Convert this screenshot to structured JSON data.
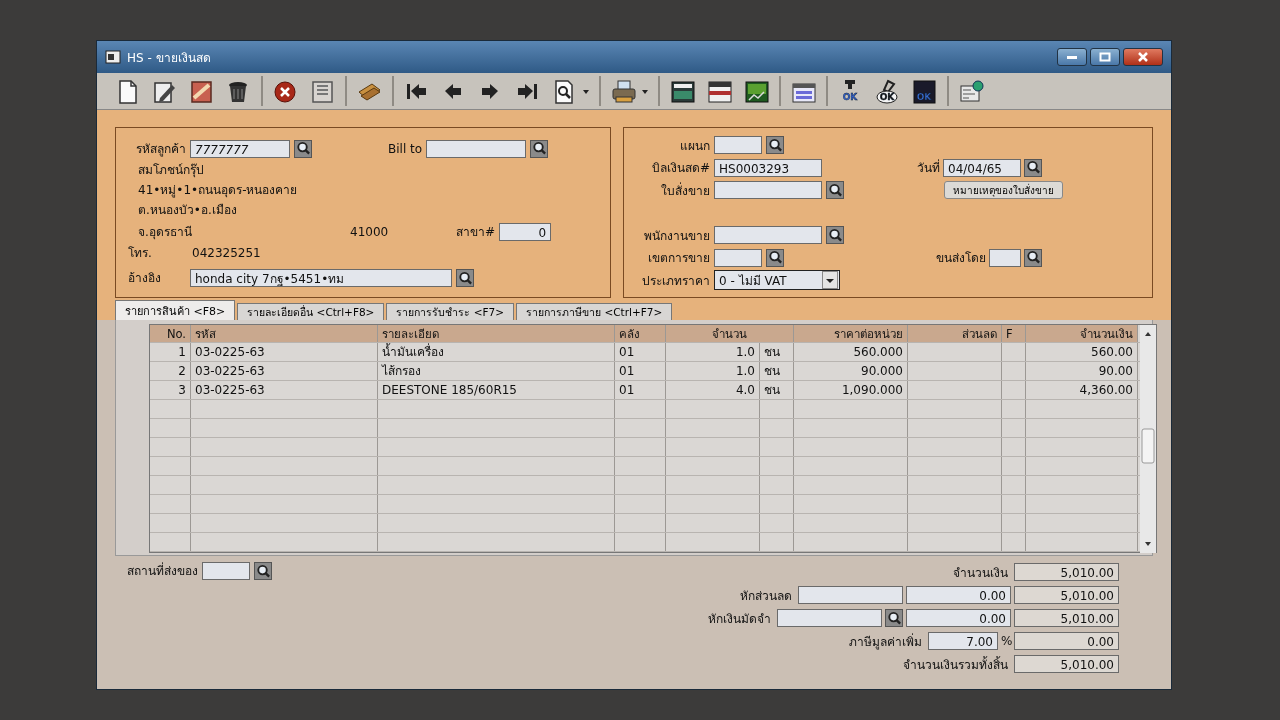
{
  "window": {
    "title": "HS - ขายเงินสด"
  },
  "toolbar": [
    [
      {
        "kind": "new"
      },
      {
        "kind": "edit"
      },
      {
        "kind": "void"
      },
      {
        "kind": "trash"
      }
    ],
    [
      {
        "kind": "cancel"
      },
      {
        "kind": "save"
      }
    ],
    [
      {
        "kind": "pay"
      }
    ],
    [
      {
        "kind": "first"
      },
      {
        "kind": "prev"
      },
      {
        "kind": "next"
      },
      {
        "kind": "last"
      },
      {
        "kind": "find",
        "dropdown": true
      }
    ],
    [
      {
        "kind": "print",
        "dropdown": true
      }
    ],
    [
      {
        "kind": "note"
      },
      {
        "kind": "card"
      },
      {
        "kind": "so"
      }
    ],
    [
      {
        "kind": "calendar"
      }
    ],
    [
      {
        "kind": "okdown",
        "text": "OK"
      },
      {
        "kind": "okpen",
        "text": "OK"
      },
      {
        "kind": "okdoc",
        "text": "OK"
      }
    ],
    [
      {
        "kind": "settings"
      }
    ]
  ],
  "customer": {
    "code_label": "รหัสลูกค้า",
    "code": "7777777",
    "bill_to_label": "Bill to",
    "name": "สมโภชน์กรุ๊ป",
    "address": [
      "41•หมู่•1•ถนนอุดร-หนองคาย",
      "ต.หนองบัว•อ.เมือง",
      "จ.อุดรธานี"
    ],
    "postcode": "41000",
    "branch_label": "สาขา#",
    "branch": "0",
    "phone_label": "โทร.",
    "phone": "042325251",
    "ref_label": "อ้างอิง",
    "ref": "honda city 7กฐ•5451•ทม"
  },
  "document": {
    "department_label": "แผนก",
    "cash_bill_label": "บิลเงินสด#",
    "cash_bill": "HS0003293",
    "date_label": "วันที่",
    "date": "04/04/65",
    "sales_order_label": "ใบสั่งขาย",
    "note_button": "หมายเหตุของใบสั่งขาย",
    "salesperson_label": "พนักงานขาย",
    "sales_area_label": "เขตการขาย",
    "shipped_by_label": "ขนส่งโดย",
    "price_type_label": "ประเภทราคา",
    "price_type": "0 - ไม่มี VAT"
  },
  "tabs": [
    {
      "label": "รายการสินค้า <F8>",
      "selected": true
    },
    {
      "label": "รายละเอียดอื่น  <Ctrl+F8>",
      "selected": false
    },
    {
      "label": "รายการรับชำระ <F7>",
      "selected": false
    },
    {
      "label": "รายการภาษีขาย <Ctrl+F7>",
      "selected": false
    }
  ],
  "table": {
    "columns": [
      "No.",
      "รหัส",
      "รายละเอียด",
      "คลัง",
      "จำนวน",
      "ราคาต่อหน่วย",
      "ส่วนลด",
      "F",
      "จำนวนเงิน"
    ],
    "rows": [
      {
        "no": "1",
        "code": "03-0225-63",
        "description": "น้ำมันเครื่อง",
        "warehouse": "01",
        "qty": "1.0",
        "unit": "ชน",
        "unit_price": "560.000",
        "amount": "560.00"
      },
      {
        "no": "2",
        "code": "03-0225-63",
        "description": "ไส้กรอง",
        "warehouse": "01",
        "qty": "1.0",
        "unit": "ชน",
        "unit_price": "90.000",
        "amount": "90.00"
      },
      {
        "no": "3",
        "code": "03-0225-63",
        "description": "DEESTONE 185/60R15",
        "warehouse": "01",
        "qty": "4.0",
        "unit": "ชน",
        "unit_price": "1,090.000",
        "amount": "4,360.00"
      }
    ]
  },
  "delivery_place_label": "สถานที่ส่งของ",
  "totals": [
    {
      "kind": "plain",
      "label": "จำนวนเงิน",
      "result": "5,010.00"
    },
    {
      "kind": "input",
      "label": "หักส่วนลด",
      "value": "0.00",
      "result": "5,010.00"
    },
    {
      "kind": "lookup",
      "label": "หักเงินมัดจำ",
      "value": "0.00",
      "result": "5,010.00"
    },
    {
      "kind": "rate",
      "label": "ภาษีมูลค่าเพิ่ม",
      "value": "7.00",
      "unit": "%",
      "result": "0.00"
    },
    {
      "kind": "plain",
      "label": "จำนวนเงินรวมทั้งสิ้น",
      "result": "5,010.00"
    }
  ]
}
